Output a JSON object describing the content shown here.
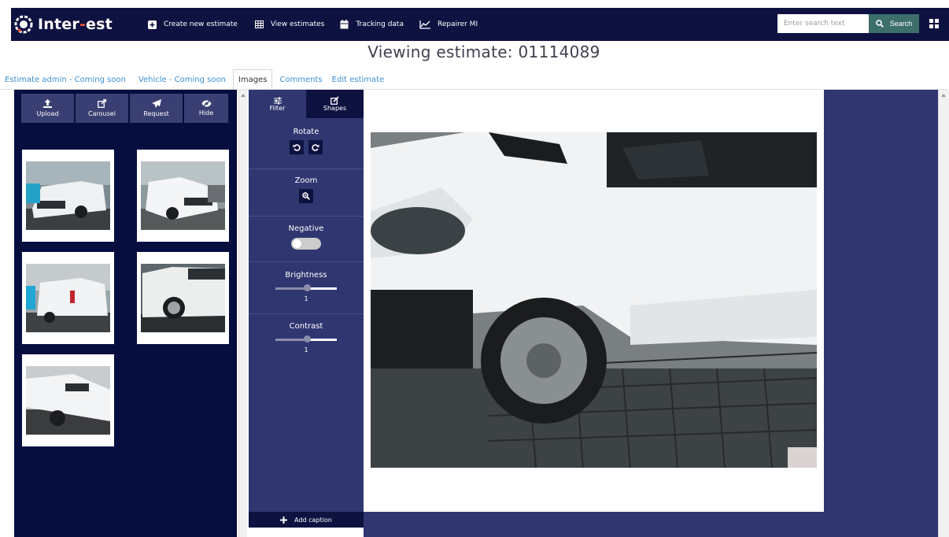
{
  "app": {
    "logo_text_a": "Inter",
    "logo_text_dash": "-",
    "logo_text_b": "est"
  },
  "nav": {
    "items": [
      {
        "label": "Create new estimate",
        "icon": "plus-square-icon"
      },
      {
        "label": "View estimates",
        "icon": "table-icon"
      },
      {
        "label": "Tracking data",
        "icon": "calendar-icon"
      },
      {
        "label": "Repairer MI",
        "icon": "line-chart-icon"
      }
    ],
    "search_placeholder": "Enter search text",
    "search_label": "Search"
  },
  "page": {
    "title": "Viewing estimate: 01114089"
  },
  "tabs": [
    {
      "label": "Estimate admin - Coming soon",
      "active": false
    },
    {
      "label": "Vehicle - Coming soon",
      "active": false
    },
    {
      "label": "Images",
      "active": true
    },
    {
      "label": "Comments",
      "active": false
    },
    {
      "label": "Edit estimate",
      "active": false
    }
  ],
  "image_tools": {
    "upload": "Upload",
    "carousel": "Carousel",
    "request": "Request",
    "hide": "Hide"
  },
  "thumbnails": [
    {
      "name": "thumbnail-front-left"
    },
    {
      "name": "thumbnail-front-right"
    },
    {
      "name": "thumbnail-rear"
    },
    {
      "name": "thumbnail-side-damage"
    },
    {
      "name": "thumbnail-front-corner"
    }
  ],
  "editor": {
    "tab_filter": "Filter",
    "tab_shapes": "Shapes",
    "rotate_label": "Rotate",
    "zoom_label": "Zoom",
    "negative_label": "Negative",
    "negative_on": false,
    "brightness_label": "Brightness",
    "brightness_value": "1",
    "contrast_label": "Contrast",
    "contrast_value": "1",
    "add_caption": "Add caption"
  },
  "colors": {
    "navbar": "#0d1240",
    "panel": "#060d3f",
    "editor": "#2f3670",
    "accent_link": "#3d8fd4",
    "search_button": "#3c6f6a",
    "logo_dash": "#e8543c"
  }
}
